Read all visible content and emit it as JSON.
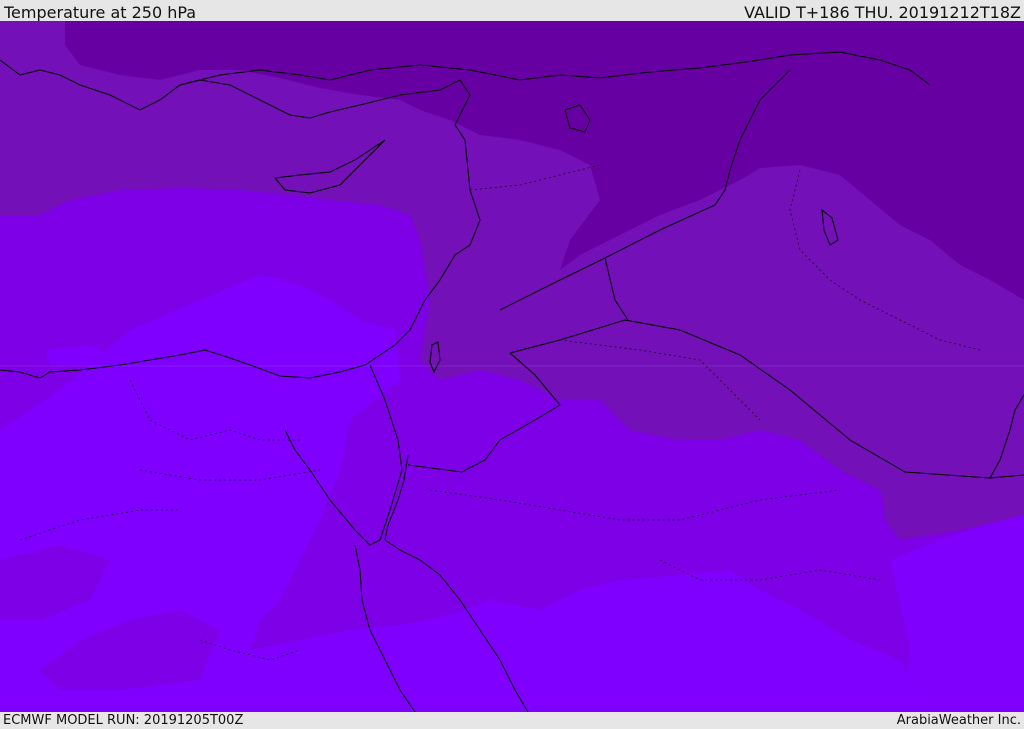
{
  "header": {
    "title": "Temperature at 250 hPa",
    "valid_time": "VALID T+186 THU. 20191212T18Z"
  },
  "footer": {
    "model_run": "ECMWF MODEL RUN: 20191205T00Z",
    "credit": "ArabiaWeather Inc."
  },
  "map": {
    "region": "Eastern Mediterranean / Middle East",
    "colors": {
      "coldest": "#6700a3",
      "cold": "#7310b8",
      "mid": "#7d00e6",
      "warm": "#7f00ff",
      "coast": "#000000"
    }
  }
}
